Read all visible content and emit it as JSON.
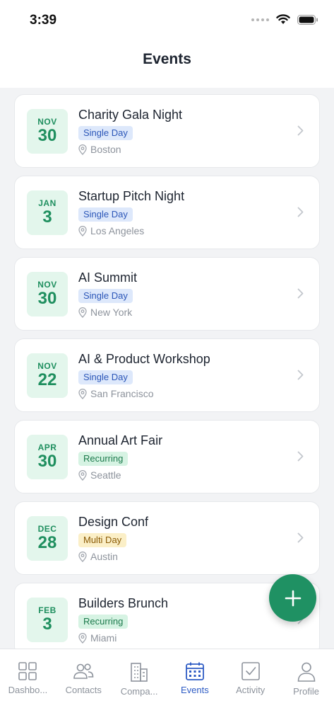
{
  "status_bar": {
    "time": "3:39"
  },
  "header": {
    "title": "Events"
  },
  "events": [
    {
      "month": "NOV",
      "day": "30",
      "title": "Charity Gala Night",
      "type": "Single Day",
      "type_style": "single",
      "location": "Boston"
    },
    {
      "month": "JAN",
      "day": "3",
      "title": "Startup Pitch Night",
      "type": "Single Day",
      "type_style": "single",
      "location": "Los Angeles"
    },
    {
      "month": "NOV",
      "day": "30",
      "title": "AI Summit",
      "type": "Single Day",
      "type_style": "single",
      "location": "New York"
    },
    {
      "month": "NOV",
      "day": "22",
      "title": "AI & Product Workshop",
      "type": "Single Day",
      "type_style": "single",
      "location": "San Francisco"
    },
    {
      "month": "APR",
      "day": "30",
      "title": "Annual Art Fair",
      "type": "Recurring",
      "type_style": "recurring",
      "location": "Seattle"
    },
    {
      "month": "DEC",
      "day": "28",
      "title": "Design Conf",
      "type": "Multi Day",
      "type_style": "multi",
      "location": "Austin"
    },
    {
      "month": "FEB",
      "day": "3",
      "title": "Builders Brunch",
      "type": "Recurring",
      "type_style": "recurring",
      "location": "Miami"
    }
  ],
  "fab": {
    "icon": "plus-icon"
  },
  "tabs": [
    {
      "label": "Dashbo...",
      "icon": "dashboard-icon",
      "active": false
    },
    {
      "label": "Contacts",
      "icon": "contacts-icon",
      "active": false
    },
    {
      "label": "Compa...",
      "icon": "companies-icon",
      "active": false
    },
    {
      "label": "Events",
      "icon": "calendar-icon",
      "active": true
    },
    {
      "label": "Activity",
      "icon": "activity-icon",
      "active": false
    },
    {
      "label": "Profile",
      "icon": "profile-icon",
      "active": false
    }
  ],
  "colors": {
    "accent_green": "#1f9163",
    "active_tab": "#2d5bc4",
    "single_day_bg": "#dde8fb",
    "recurring_bg": "#d6f3e3",
    "multi_day_bg": "#fbefc7"
  }
}
